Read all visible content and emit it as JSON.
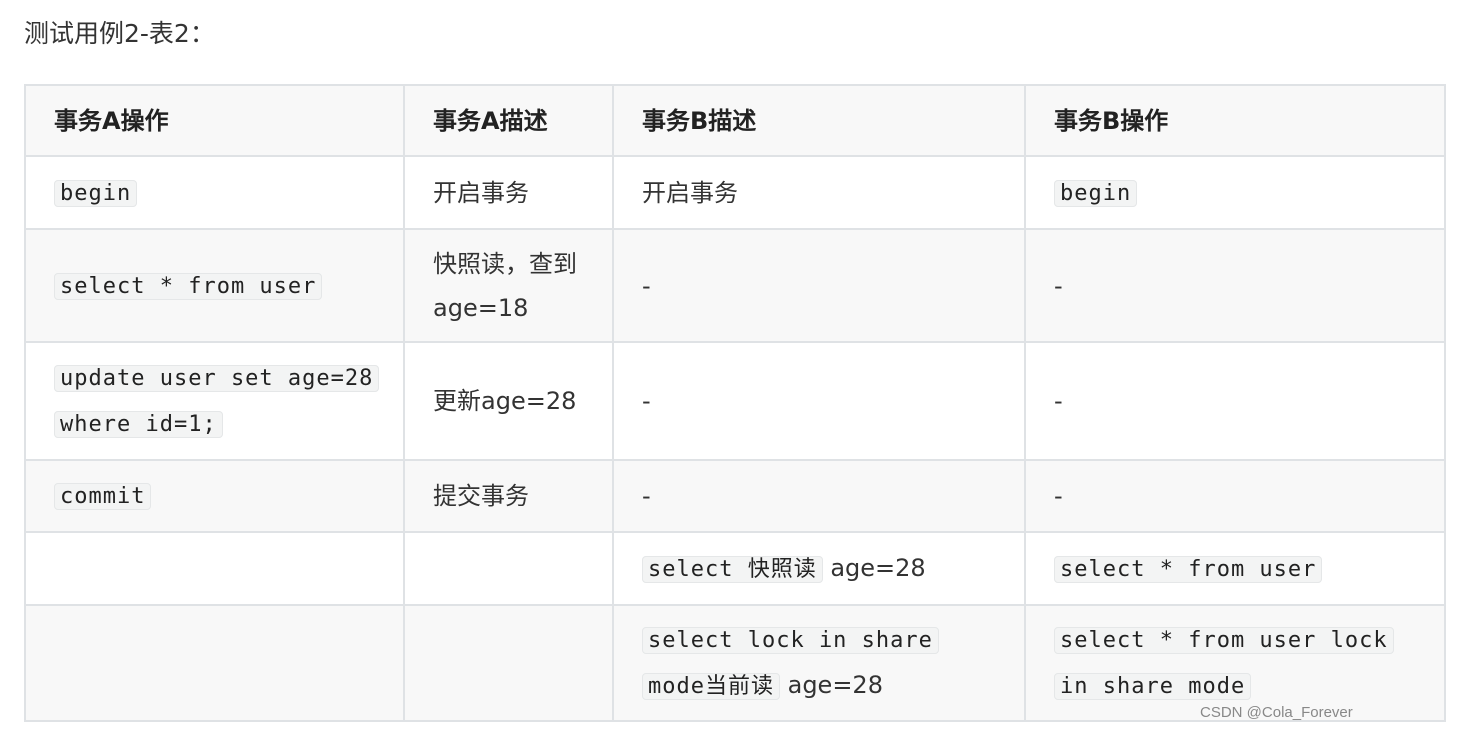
{
  "caption": "测试用例2-表2：",
  "table": {
    "headers": [
      "事务A操作",
      "事务A描述",
      "事务B描述",
      "事务B操作"
    ],
    "rows": [
      {
        "a_op": "begin",
        "a_desc": "开启事务",
        "b_desc": "开启事务",
        "b_op": "begin"
      },
      {
        "a_op": "select * from user",
        "a_desc": "快照读，查到age=18",
        "b_desc": "-",
        "b_op": "-"
      },
      {
        "a_op": "update user set age=28 where id=1;",
        "a_desc": "更新age=28",
        "b_desc": "-",
        "b_op": "-"
      },
      {
        "a_op": "commit",
        "a_desc": "提交事务",
        "b_desc": "-",
        "b_op": "-"
      },
      {
        "a_op": "",
        "a_desc": "",
        "b_desc_code": "select 快照读",
        "b_desc_text": " age=28",
        "b_op": "select * from user"
      },
      {
        "a_op": "",
        "a_desc": "",
        "b_desc_code": "select lock in share mode当前读",
        "b_desc_text": " age=28",
        "b_op": "select * from user lock in share mode"
      }
    ]
  },
  "watermark": "CSDN @Cola_Forever"
}
